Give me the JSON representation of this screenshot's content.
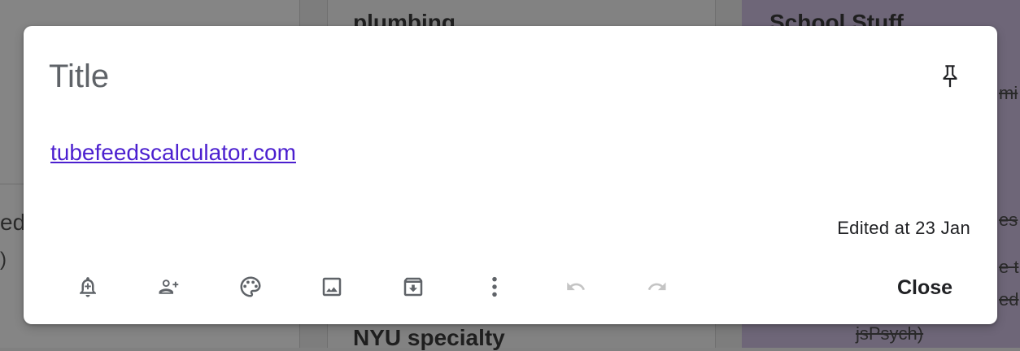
{
  "background": {
    "notes": [
      {
        "title": "plumbing"
      },
      {
        "title": "School Stuff"
      },
      {
        "title": "NYU specialty"
      }
    ],
    "fragments": {
      "left_a": "ed:",
      "left_b": ")",
      "right_a": "mi",
      "right_b": "es",
      "right_c": "e t",
      "right_d": "ed",
      "right_e": "jsPsych)"
    }
  },
  "modal": {
    "title_placeholder": "Title",
    "title_value": "",
    "body_link": "tubefeedscalculator.com",
    "edited": "Edited at 23 Jan",
    "close_label": "Close"
  },
  "toolbar": {
    "icons": [
      "remind-me-icon",
      "collaborator-icon",
      "palette-icon",
      "image-icon",
      "archive-icon",
      "more-vert-icon",
      "undo-icon",
      "redo-icon"
    ]
  },
  "colors": {
    "overlay": "#808080",
    "link": "#4b1fcf",
    "icon": "#5f6368",
    "icon_disabled": "#c4c4c4",
    "highlighted_note": "#6e6678"
  }
}
